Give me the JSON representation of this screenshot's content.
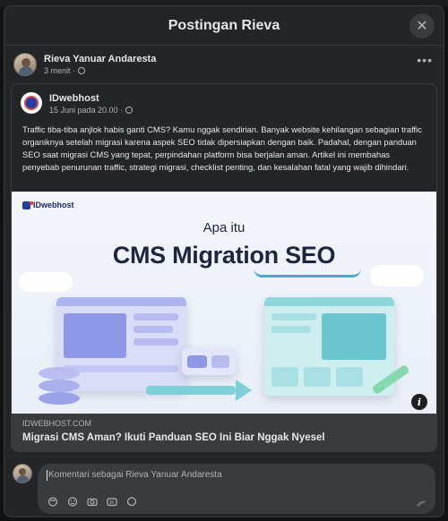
{
  "dialog": {
    "title": "Postingan Rieva"
  },
  "post": {
    "author": "Rieva Yanuar Andaresta",
    "time": "3 menit ·",
    "more_icon": "more-horizontal-icon"
  },
  "shared": {
    "author": "IDwebhost",
    "time": "15 Juni pada 20.00 ·",
    "text": "Traffic tiba-tiba anjlok habis ganti CMS? Kamu nggak sendirian. Banyak website kehilangan sebagian traffic organiknya setelah migrasi karena aspek SEO tidak dipersiapkan dengan baik. Padahal, dengan panduan SEO saat migrasi CMS yang tepat, perpindahan platform bisa berjalan aman. Artikel ini membahas penyebab penurunan traffic, strategi migrasi, checklist penting, dan kesalahan fatal yang wajib dihindari."
  },
  "link": {
    "image_brand": "IDwebhost",
    "image_subtitle": "Apa itu",
    "image_title": "CMS Migration SEO",
    "domain": "IDWEBHOST.COM",
    "title": "Migrasi CMS Aman? Ikuti Panduan SEO Ini Biar Nggak Nyesel"
  },
  "comment": {
    "placeholder": "Komentari sebagai Rieva Yanuar Andaresta",
    "tools": [
      "avatar-sticker-icon",
      "emoji-icon",
      "camera-icon",
      "gif-icon",
      "sticker-icon"
    ],
    "send_icon": "send-icon"
  },
  "colors": {
    "modal_bg": "#242526",
    "card_footer": "#3a3b3c",
    "text_primary": "#e4e6eb",
    "text_secondary": "#b0b3b8",
    "brand_blue": "#1e3fa8",
    "brand_red": "#e84040"
  }
}
